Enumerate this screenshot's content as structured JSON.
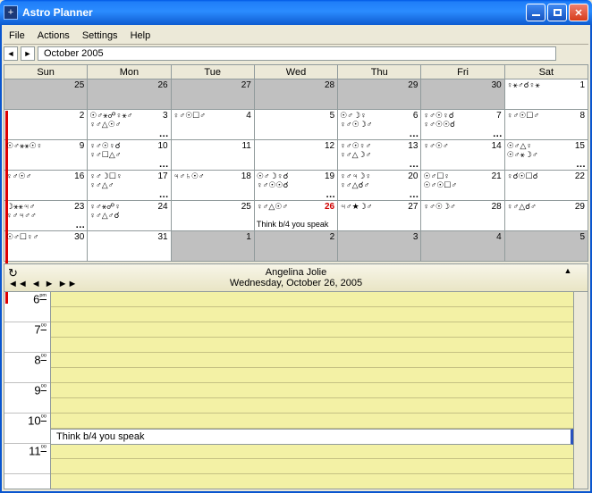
{
  "window": {
    "title": "Astro Planner"
  },
  "menu": {
    "file": "File",
    "actions": "Actions",
    "settings": "Settings",
    "help": "Help"
  },
  "nav": {
    "month": "October 2005"
  },
  "cal": {
    "headers": [
      "Sun",
      "Mon",
      "Tue",
      "Wed",
      "Thu",
      "Fri",
      "Sat"
    ],
    "weeks": [
      [
        {
          "d": "25",
          "g": true
        },
        {
          "d": "26",
          "g": true
        },
        {
          "d": "27",
          "g": true
        },
        {
          "d": "28",
          "g": true
        },
        {
          "d": "29",
          "g": true
        },
        {
          "d": "30",
          "g": true
        },
        {
          "d": "1",
          "a1": "♀⚹♂☌♀⚹"
        }
      ],
      [
        {
          "d": "2"
        },
        {
          "d": "3",
          "a1": "☉♂⚹☍♀⚹♂",
          "a2": "♀♂△☉♂",
          "dots": true
        },
        {
          "d": "4",
          "a1": "♀♂☉☐♂"
        },
        {
          "d": "5"
        },
        {
          "d": "6",
          "a1": "☉♂☽♀",
          "a2": "♀♂☉☽♂",
          "dots": true
        },
        {
          "d": "7",
          "a1": "♀♂☉♀☌",
          "a2": "♀♂☉☉☌",
          "dots": true
        },
        {
          "d": "8",
          "a1": "♀♂☉☐♂"
        }
      ],
      [
        {
          "d": "9",
          "a1": "☉♂⚹⚹☉♀"
        },
        {
          "d": "10",
          "a1": "♀♂☉♀☌",
          "a2": "♀♂☐△♂",
          "dots": true
        },
        {
          "d": "11"
        },
        {
          "d": "12"
        },
        {
          "d": "13",
          "a1": "♀♂☉♀♂",
          "a2": "♀♂△☽♂",
          "dots": true
        },
        {
          "d": "14",
          "a1": "♀♂☉♂"
        },
        {
          "d": "15",
          "a1": "☉♂△♀",
          "a2": "☉♂⚹☽♂",
          "dots": true
        }
      ],
      [
        {
          "d": "16",
          "a1": "♀♂☉♂"
        },
        {
          "d": "17",
          "a1": "♀♂☽☐♀",
          "a2": "♀♂△♂",
          "dots": true
        },
        {
          "d": "18",
          "a1": "♃♂♄☉♂"
        },
        {
          "d": "19",
          "a1": "☉♂☽♀☌",
          "a2": "♀♂☉☉☌",
          "dots": true
        },
        {
          "d": "20",
          "a1": "♀♂♃☽♀",
          "a2": "♀♂△☌♂",
          "dots": true
        },
        {
          "d": "21",
          "a1": "☉♂☐♀",
          "a2": "☉♂☉☐♂"
        },
        {
          "d": "22",
          "a1": "♀☌☉☐☌"
        }
      ],
      [
        {
          "d": "23",
          "a1": "☽⚹⚹♃♂",
          "a2": "♀♂♃♂♂",
          "dots": true
        },
        {
          "d": "24",
          "a1": "♀♂⚹☍♀",
          "a2": "♀♂△♂☌"
        },
        {
          "d": "25"
        },
        {
          "d": "26",
          "red": true,
          "a1": "♀♂△☉♂",
          "note": "Think b/4 you speak"
        },
        {
          "d": "27",
          "a1": "♃♂★☽♂"
        },
        {
          "d": "28",
          "a1": "♀♂☉☽♂"
        },
        {
          "d": "29",
          "a1": "♀♂△☌♂"
        }
      ],
      [
        {
          "d": "30",
          "a1": "☉♂☐♀♂"
        },
        {
          "d": "31"
        },
        {
          "d": "1",
          "g": true
        },
        {
          "d": "2",
          "g": true
        },
        {
          "d": "3",
          "g": true
        },
        {
          "d": "4",
          "g": true
        },
        {
          "d": "5",
          "g": true
        }
      ]
    ]
  },
  "detail": {
    "person": "Angelina Jolie",
    "date": "Wednesday, October 26, 2005",
    "times": [
      "6ᵖᵐ",
      "7⁰⁰",
      "8⁰⁰",
      "9⁰⁰",
      "10⁰⁰",
      "11⁰⁰"
    ],
    "entry": "Think b/4 you speak"
  }
}
